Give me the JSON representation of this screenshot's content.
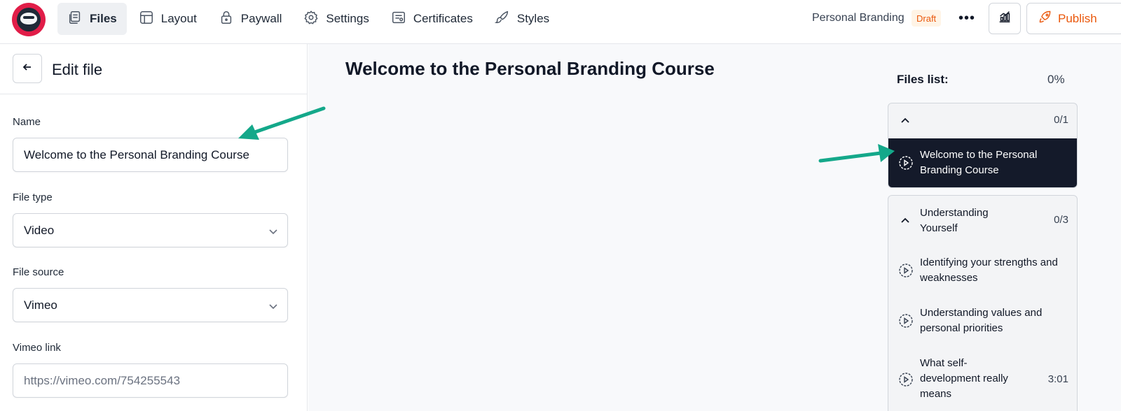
{
  "header": {
    "nav": [
      {
        "label": "Files",
        "icon": "files-icon",
        "active": true
      },
      {
        "label": "Layout",
        "icon": "layout-icon",
        "active": false
      },
      {
        "label": "Paywall",
        "icon": "lock-icon",
        "active": false
      },
      {
        "label": "Settings",
        "icon": "gear-icon",
        "active": false
      },
      {
        "label": "Certificates",
        "icon": "certificate-icon",
        "active": false
      },
      {
        "label": "Styles",
        "icon": "brush-icon",
        "active": false
      }
    ],
    "course_title": "Personal Branding",
    "status_badge": "Draft",
    "more_label": "•••",
    "publish_label": "Publish"
  },
  "edit_panel": {
    "title": "Edit file",
    "name_label": "Name",
    "name_value": "Welcome to the Personal Branding Course",
    "file_type_label": "File type",
    "file_type_value": "Video",
    "file_source_label": "File source",
    "file_source_value": "Vimeo",
    "vimeo_link_label": "Vimeo link",
    "vimeo_link_placeholder": "https://vimeo.com/754255543"
  },
  "main": {
    "title": "Welcome to the Personal Branding Course"
  },
  "files_list": {
    "label": "Files list:",
    "progress": "0%",
    "groups": [
      {
        "title": "",
        "count": "0/1",
        "items": [
          {
            "title": "Welcome to the Personal Branding Course",
            "duration": "",
            "active": true
          }
        ]
      },
      {
        "title": "Understanding Yourself",
        "count": "0/3",
        "items": [
          {
            "title": "Identifying your strengths and weaknesses",
            "duration": "",
            "active": false
          },
          {
            "title": "Understanding values and personal priorities",
            "duration": "",
            "active": false
          },
          {
            "title": "What self-development really means",
            "duration": "3:01",
            "active": false
          }
        ]
      }
    ]
  },
  "colors": {
    "accent": "#ea580c",
    "active_item_bg": "#141a2a",
    "annotation_arrow": "#14a88a",
    "logo_red": "#e11d48"
  }
}
